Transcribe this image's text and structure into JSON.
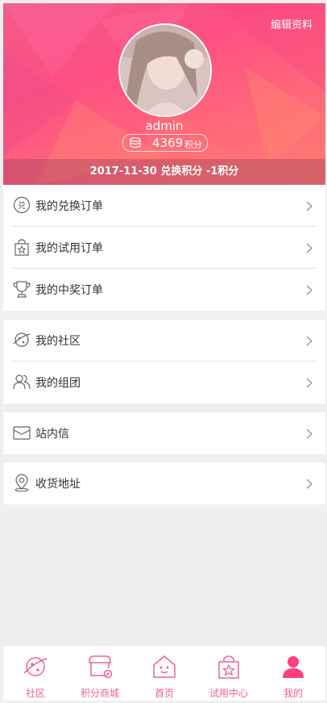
{
  "header": {
    "edit_label": "编辑资料",
    "username": "admin",
    "points_value": "4369",
    "points_unit": "积分",
    "notice": "2017-11-30  兑换积分 -1积分"
  },
  "menu": {
    "exchange_orders": "我的兑换订单",
    "trial_orders": "我的试用订单",
    "prize_orders": "我的中奖订单",
    "community": "我的社区",
    "group": "我的组团",
    "messages": "站内信",
    "address": "收货地址"
  },
  "tabs": {
    "community": "社区",
    "points_mall": "积分商城",
    "home": "首页",
    "trial_center": "试用中心",
    "mine": "我的"
  },
  "colors": {
    "accent": "#f06292",
    "active": "#ff3d7f"
  }
}
